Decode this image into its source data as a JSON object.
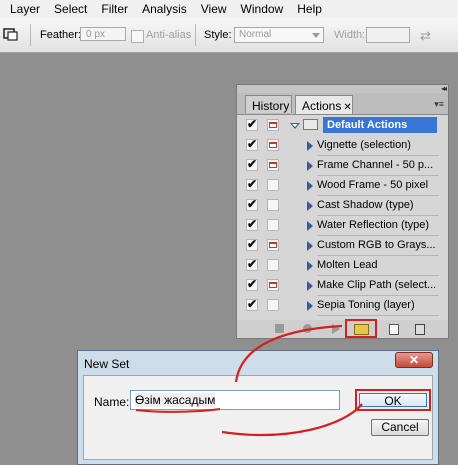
{
  "menubar": {
    "items": [
      "Layer",
      "Select",
      "Filter",
      "Analysis",
      "View",
      "Window",
      "Help"
    ]
  },
  "options": {
    "tool_icon": "marquee-tool-icon",
    "feather_label": "Feather:",
    "feather_value": "0 px",
    "antialias_label": "Anti-alias",
    "style_label": "Style:",
    "style_value": "Normal",
    "width_label": "Width:",
    "swap_icon": "⇄"
  },
  "panel": {
    "tabs": {
      "history": "History",
      "actions": "Actions"
    },
    "close_glyph": "✕",
    "menu_glyph": "▾≡",
    "collapse_glyph": "◂◂",
    "set": {
      "name": "Default Actions",
      "checked": true,
      "dialog": true
    },
    "actions": [
      {
        "name": "Vignette (selection)",
        "checked": true,
        "dialog": true
      },
      {
        "name": "Frame Channel - 50 p...",
        "checked": true,
        "dialog": true
      },
      {
        "name": "Wood Frame - 50 pixel",
        "checked": true,
        "dialog": false
      },
      {
        "name": "Cast Shadow (type)",
        "checked": true,
        "dialog": false
      },
      {
        "name": "Water Reflection (type)",
        "checked": true,
        "dialog": false
      },
      {
        "name": "Custom RGB to Grays...",
        "checked": true,
        "dialog": true
      },
      {
        "name": "Molten Lead",
        "checked": true,
        "dialog": false
      },
      {
        "name": "Make Clip Path (select...",
        "checked": true,
        "dialog": true
      },
      {
        "name": "Sepia Toning (layer)",
        "checked": true,
        "dialog": false
      }
    ]
  },
  "dialog": {
    "title": "New Set",
    "close_glyph": "✕",
    "name_label": "Name:",
    "name_value": "Өзім жасадым",
    "ok_label": "OK",
    "cancel_label": "Cancel"
  },
  "colors": {
    "highlight": "#3875d7",
    "annotation": "#d32020"
  }
}
